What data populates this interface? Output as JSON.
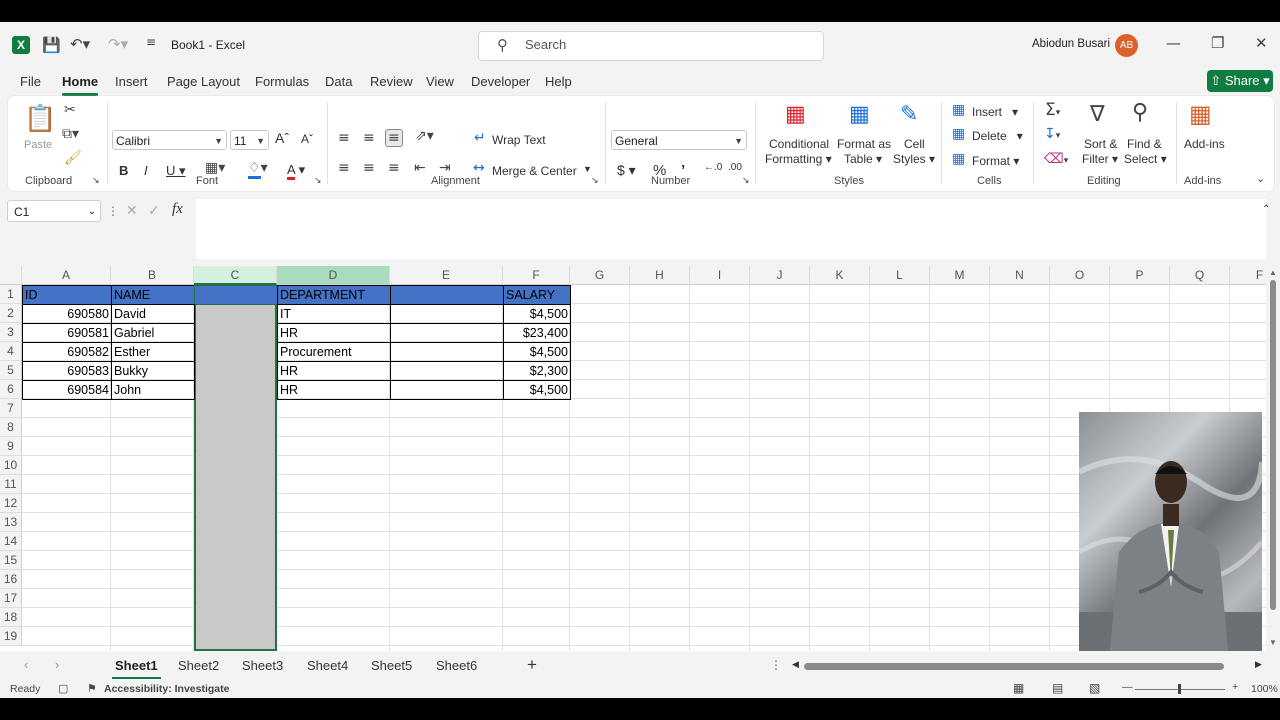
{
  "window": {
    "app_icon": "excel-logo",
    "title": "Book1  -  Excel",
    "search_placeholder": "Search",
    "user_name": "Abiodun Busari",
    "user_initials": "AB"
  },
  "menu_tabs": [
    "File",
    "Home",
    "Insert",
    "Page Layout",
    "Formulas",
    "Data",
    "Review",
    "View",
    "Developer",
    "Help"
  ],
  "active_tab": "Home",
  "share_label": "Share",
  "ribbon": {
    "clipboard": {
      "paste": "Paste",
      "label": "Clipboard"
    },
    "font": {
      "name": "Calibri",
      "size": "11",
      "label": "Font"
    },
    "alignment": {
      "wrap": "Wrap Text",
      "merge": "Merge & Center",
      "label": "Alignment"
    },
    "number": {
      "format": "General",
      "label": "Number"
    },
    "styles": {
      "cond1": "Conditional",
      "cond2": "Formatting",
      "fat1": "Format as",
      "fat2": "Table",
      "cs1": "Cell",
      "cs2": "Styles",
      "label": "Styles"
    },
    "cells": {
      "insert": "Insert",
      "delete": "Delete",
      "format": "Format",
      "label": "Cells"
    },
    "editing": {
      "sort1": "Sort &",
      "sort2": "Filter",
      "find1": "Find &",
      "find2": "Select",
      "label": "Editing"
    },
    "addins": {
      "btn": "Add-ins",
      "label": "Add-ins"
    }
  },
  "formula_bar": {
    "name_box": "C1",
    "fx": "fx",
    "formula": ""
  },
  "columns": [
    "A",
    "B",
    "C",
    "D",
    "E",
    "F",
    "G",
    "H",
    "I",
    "J",
    "K",
    "L",
    "M",
    "N",
    "O",
    "P",
    "Q",
    "F"
  ],
  "rows": [
    "1",
    "2",
    "3",
    "4",
    "5",
    "6",
    "7",
    "8",
    "9",
    "10",
    "11",
    "12",
    "13",
    "14",
    "15",
    "16",
    "17",
    "18",
    "19"
  ],
  "table": {
    "headers": {
      "A": "ID",
      "B": "NAME",
      "C": "",
      "D": "DEPARTMENT",
      "E": "",
      "F": "SALARY"
    },
    "data": [
      {
        "A": "690580",
        "B": "David",
        "D": "IT",
        "F": "$4,500"
      },
      {
        "A": "690581",
        "B": "Gabriel",
        "D": "HR",
        "F": "$23,400"
      },
      {
        "A": "690582",
        "B": "Esther",
        "D": "Procurement",
        "F": "$4,500"
      },
      {
        "A": "690583",
        "B": "Bukky",
        "D": "HR",
        "F": "$2,300"
      },
      {
        "A": "690584",
        "B": "John",
        "D": "HR",
        "F": "$4,500"
      }
    ]
  },
  "sheets": [
    "Sheet1",
    "Sheet2",
    "Sheet3",
    "Sheet4",
    "Sheet5",
    "Sheet6"
  ],
  "active_sheet": "Sheet1",
  "status": {
    "ready": "Ready",
    "accessibility": "Accessibility: Investigate",
    "zoom": "100%"
  },
  "colors": {
    "accent": "#107c41",
    "header_fill": "#4472c4",
    "selection_fill": "#c9c9c9",
    "avatar": "#d9622b"
  }
}
